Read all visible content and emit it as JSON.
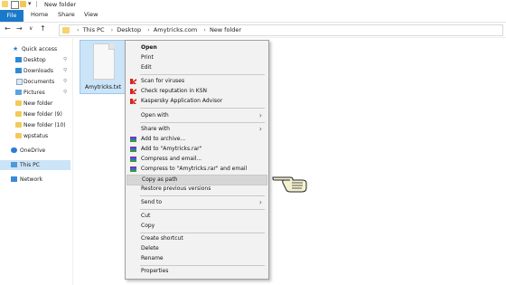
{
  "window": {
    "title": "New folder"
  },
  "ribbon": {
    "tabs": [
      "File",
      "Home",
      "Share",
      "View"
    ]
  },
  "address": {
    "nav": {
      "back": "←",
      "forward": "→",
      "recent": "∨",
      "up": "↑"
    },
    "crumbs": [
      "This PC",
      "Desktop",
      "Amytricks.com",
      "New folder"
    ],
    "sep": "›"
  },
  "navpane": {
    "items": [
      {
        "label": "Quick access",
        "icon": "star-icon",
        "pinned": false
      },
      {
        "label": "Desktop",
        "icon": "desktop-icon",
        "pinned": true
      },
      {
        "label": "Downloads",
        "icon": "downloads-icon",
        "pinned": true
      },
      {
        "label": "Documents",
        "icon": "documents-icon",
        "pinned": true
      },
      {
        "label": "Pictures",
        "icon": "pictures-icon",
        "pinned": true
      },
      {
        "label": "New folder",
        "icon": "folder-icon",
        "pinned": false
      },
      {
        "label": "New folder (9)",
        "icon": "folder-icon",
        "pinned": false
      },
      {
        "label": "New folder (10)",
        "icon": "folder-icon",
        "pinned": false
      },
      {
        "label": "wpstatus",
        "icon": "folder-icon",
        "pinned": false
      },
      {
        "label": "OneDrive",
        "icon": "onedrive-icon",
        "pinned": false
      },
      {
        "label": "This PC",
        "icon": "this-pc-icon",
        "pinned": false
      },
      {
        "label": "Network",
        "icon": "network-icon",
        "pinned": false
      }
    ],
    "pin_glyph": "📌"
  },
  "file": {
    "name": "Amytricks.txt"
  },
  "context_menu": {
    "items": {
      "open": "Open",
      "print": "Print",
      "edit": "Edit",
      "scan": "Scan for viruses",
      "check": "Check reputation in KSN",
      "advisor": "Kaspersky Application Advisor",
      "open_with": "Open with",
      "share_with": "Share with",
      "add_archive": "Add to archive...",
      "add_rar": "Add to \"Amytricks.rar\"",
      "compress_email": "Compress and email...",
      "compress_rar_email": "Compress to \"Amytricks.rar\" and email",
      "copy_path": "Copy as path",
      "restore": "Restore previous versions",
      "send_to": "Send to",
      "cut": "Cut",
      "copy": "Copy",
      "create_shortcut": "Create shortcut",
      "delete": "Delete",
      "rename": "Rename",
      "properties": "Properties"
    },
    "submenu_arrow": "›",
    "highlighted": "Copy as path"
  },
  "colors": {
    "accent": "#1979ca",
    "selection": "#cce4f7",
    "menu_bg": "#f2f2f2",
    "menu_highlight": "#d6d6d6"
  }
}
